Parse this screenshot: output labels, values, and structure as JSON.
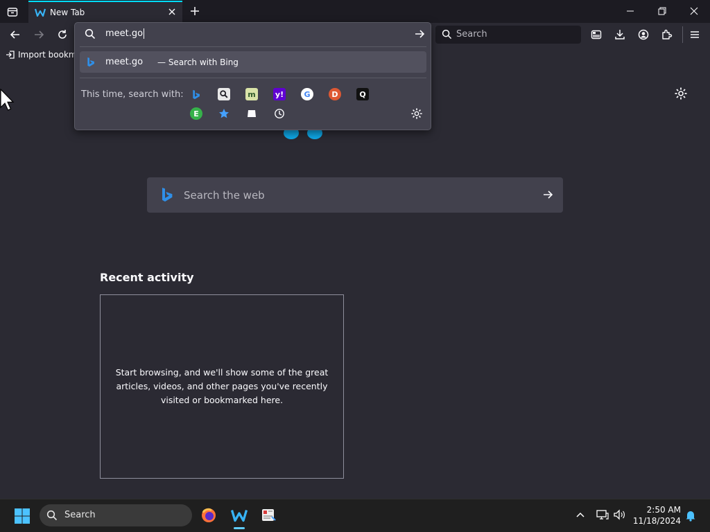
{
  "browser": {
    "tab": {
      "title": "New Tab"
    },
    "urlbar": {
      "value": "meet.go",
      "result_main": "meet.go",
      "result_sub": "— Search with Bing",
      "oneoff_label": "This time, search with:",
      "engines_row1": [
        "bing-icon",
        "search-tool-icon",
        "merriam-webster-icon",
        "yahoo-icon",
        "google-icon",
        "duckduckgo-icon",
        "qwant-icon"
      ],
      "engines_row2": [
        "ecosia-icon",
        "bookmarks-star-icon",
        "tabs-icon",
        "history-clock-icon"
      ]
    },
    "searchbar": {
      "placeholder": "Search"
    },
    "bookmarks": {
      "import_label": "Import bookma"
    }
  },
  "newtab": {
    "search_placeholder": "Search the web",
    "recent_title": "Recent activity",
    "recent_empty_text": "Start browsing, and we'll show some of the great articles, videos, and other pages you've recently visited or bookmarked here."
  },
  "taskbar": {
    "search_label": "Search",
    "time": "2:50 AM",
    "date": "11/18/2024"
  },
  "colors": {
    "accent_tab": "#00ddff",
    "content_bg": "#2b2a33",
    "chrome_dark": "#1c1b22",
    "taskbar_indicator": "#60cdff"
  }
}
